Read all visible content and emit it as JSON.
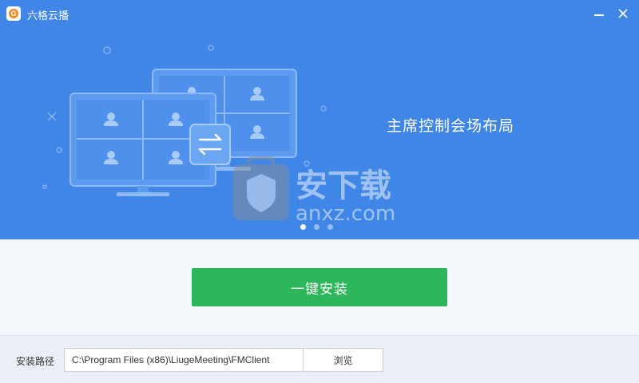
{
  "window": {
    "title": "六格云播",
    "logo_icon": "app-logo-icon",
    "minimize_icon": "minimize-icon",
    "close_icon": "close-icon"
  },
  "hero": {
    "slogan": "主席控制会场布局",
    "background_color": "#3f86e6",
    "carousel": {
      "count": 3,
      "active_index": 0
    }
  },
  "install": {
    "button_label": "一键安装",
    "button_color": "#2eb75a"
  },
  "footer": {
    "path_label": "安装路径",
    "path_value": "C:\\Program Files (x86)\\LiugeMeeting\\FMClient",
    "browse_label": "浏览"
  },
  "watermark": {
    "text": "安下载",
    "domain": "anxz.com"
  }
}
